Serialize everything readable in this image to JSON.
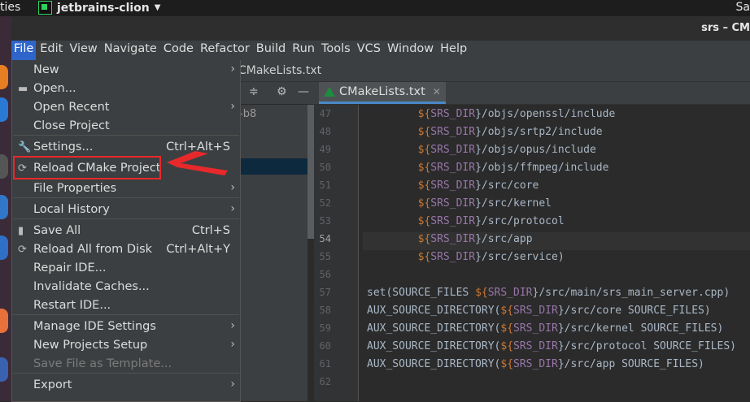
{
  "os_topbar": {
    "activities": "ties",
    "app_name": "jetbrains-clion",
    "right_text": "Sa"
  },
  "window": {
    "title": "srs – CM"
  },
  "menubar": {
    "items": [
      "File",
      "Edit",
      "View",
      "Navigate",
      "Code",
      "Refactor",
      "Build",
      "Run",
      "Tools",
      "VCS",
      "Window",
      "Help"
    ]
  },
  "navbar": {
    "breadcrumb": "CMakeLists.txt"
  },
  "project_panel": {
    "partial_label": "-b8"
  },
  "editor_tab": {
    "label": "CMakeLists.txt"
  },
  "file_menu": {
    "items": [
      {
        "label": "New",
        "shortcut": "",
        "submenu": true,
        "icon": ""
      },
      {
        "label": "Open...",
        "shortcut": "",
        "submenu": false,
        "icon": "folder-icon"
      },
      {
        "label": "Open Recent",
        "shortcut": "",
        "submenu": true,
        "icon": ""
      },
      {
        "label": "Close Project",
        "shortcut": "",
        "submenu": false,
        "icon": ""
      },
      {
        "label": "Settings...",
        "shortcut": "Ctrl+Alt+S",
        "submenu": false,
        "icon": "wrench-icon"
      },
      {
        "label": "Reload CMake Project",
        "shortcut": "",
        "submenu": false,
        "icon": "reload-icon"
      },
      {
        "label": "File Properties",
        "shortcut": "",
        "submenu": true,
        "icon": ""
      },
      {
        "label": "Local History",
        "shortcut": "",
        "submenu": true,
        "icon": ""
      },
      {
        "label": "Save All",
        "shortcut": "Ctrl+S",
        "submenu": false,
        "icon": "save-icon"
      },
      {
        "label": "Reload All from Disk",
        "shortcut": "Ctrl+Alt+Y",
        "submenu": false,
        "icon": "reload-icon"
      },
      {
        "label": "Repair IDE...",
        "shortcut": "",
        "submenu": false,
        "icon": ""
      },
      {
        "label": "Invalidate Caches...",
        "shortcut": "",
        "submenu": false,
        "icon": ""
      },
      {
        "label": "Restart IDE...",
        "shortcut": "",
        "submenu": false,
        "icon": ""
      },
      {
        "label": "Manage IDE Settings",
        "shortcut": "",
        "submenu": true,
        "icon": ""
      },
      {
        "label": "New Projects Setup",
        "shortcut": "",
        "submenu": true,
        "icon": ""
      },
      {
        "label": "Save File as Template...",
        "shortcut": "",
        "submenu": false,
        "icon": "",
        "disabled": true
      },
      {
        "label": "Export",
        "shortcut": "",
        "submenu": true,
        "icon": ""
      }
    ]
  },
  "editor": {
    "current_line": "54",
    "lines": [
      {
        "n": "47",
        "dollar": "${",
        "var": "SRS_DIR",
        "rest": "}/objs/openssl/include",
        "indent": "        ",
        "prefix": ""
      },
      {
        "n": "48",
        "dollar": "${",
        "var": "SRS_DIR",
        "rest": "}/objs/srtp2/include",
        "indent": "        ",
        "prefix": ""
      },
      {
        "n": "49",
        "dollar": "${",
        "var": "SRS_DIR",
        "rest": "}/objs/opus/include",
        "indent": "        ",
        "prefix": ""
      },
      {
        "n": "50",
        "dollar": "${",
        "var": "SRS_DIR",
        "rest": "}/objs/ffmpeg/include",
        "indent": "        ",
        "prefix": ""
      },
      {
        "n": "51",
        "dollar": "${",
        "var": "SRS_DIR",
        "rest": "}/src/core",
        "indent": "        ",
        "prefix": ""
      },
      {
        "n": "52",
        "dollar": "${",
        "var": "SRS_DIR",
        "rest": "}/src/kernel",
        "indent": "        ",
        "prefix": ""
      },
      {
        "n": "53",
        "dollar": "${",
        "var": "SRS_DIR",
        "rest": "}/src/protocol",
        "indent": "        ",
        "prefix": ""
      },
      {
        "n": "54",
        "dollar": "${",
        "var": "SRS_DIR",
        "rest": "}/src/app",
        "indent": "        ",
        "prefix": ""
      },
      {
        "n": "55",
        "dollar": "${",
        "var": "SRS_DIR",
        "rest": "}/src/service)",
        "indent": "        ",
        "prefix": ""
      },
      {
        "n": "56",
        "dollar": "",
        "var": "",
        "rest": "",
        "indent": "",
        "prefix": ""
      },
      {
        "n": "57",
        "dollar": "${",
        "var": "SRS_DIR",
        "rest": "}/src/main/srs_main_server.cpp)",
        "indent": "",
        "prefix": "set(SOURCE_FILES "
      },
      {
        "n": "58",
        "dollar": "${",
        "var": "SRS_DIR",
        "rest": "}/src/core SOURCE_FILES)",
        "indent": "",
        "prefix": "AUX_SOURCE_DIRECTORY("
      },
      {
        "n": "59",
        "dollar": "${",
        "var": "SRS_DIR",
        "rest": "}/src/kernel SOURCE_FILES)",
        "indent": "",
        "prefix": "AUX_SOURCE_DIRECTORY("
      },
      {
        "n": "60",
        "dollar": "${",
        "var": "SRS_DIR",
        "rest": "}/src/protocol SOURCE_FILES)",
        "indent": "",
        "prefix": "AUX_SOURCE_DIRECTORY("
      },
      {
        "n": "61",
        "dollar": "${",
        "var": "SRS_DIR",
        "rest": "}/src/app SOURCE_FILES)",
        "indent": "",
        "prefix": "AUX_SOURCE_DIRECTORY("
      },
      {
        "n": "62",
        "dollar": "",
        "var": "",
        "rest": "",
        "indent": "",
        "prefix": ""
      }
    ]
  },
  "colors": {
    "accent": "#2f65ca",
    "annotation": "#e8292b",
    "keyword": "#cc7832",
    "variable": "#9876aa"
  }
}
